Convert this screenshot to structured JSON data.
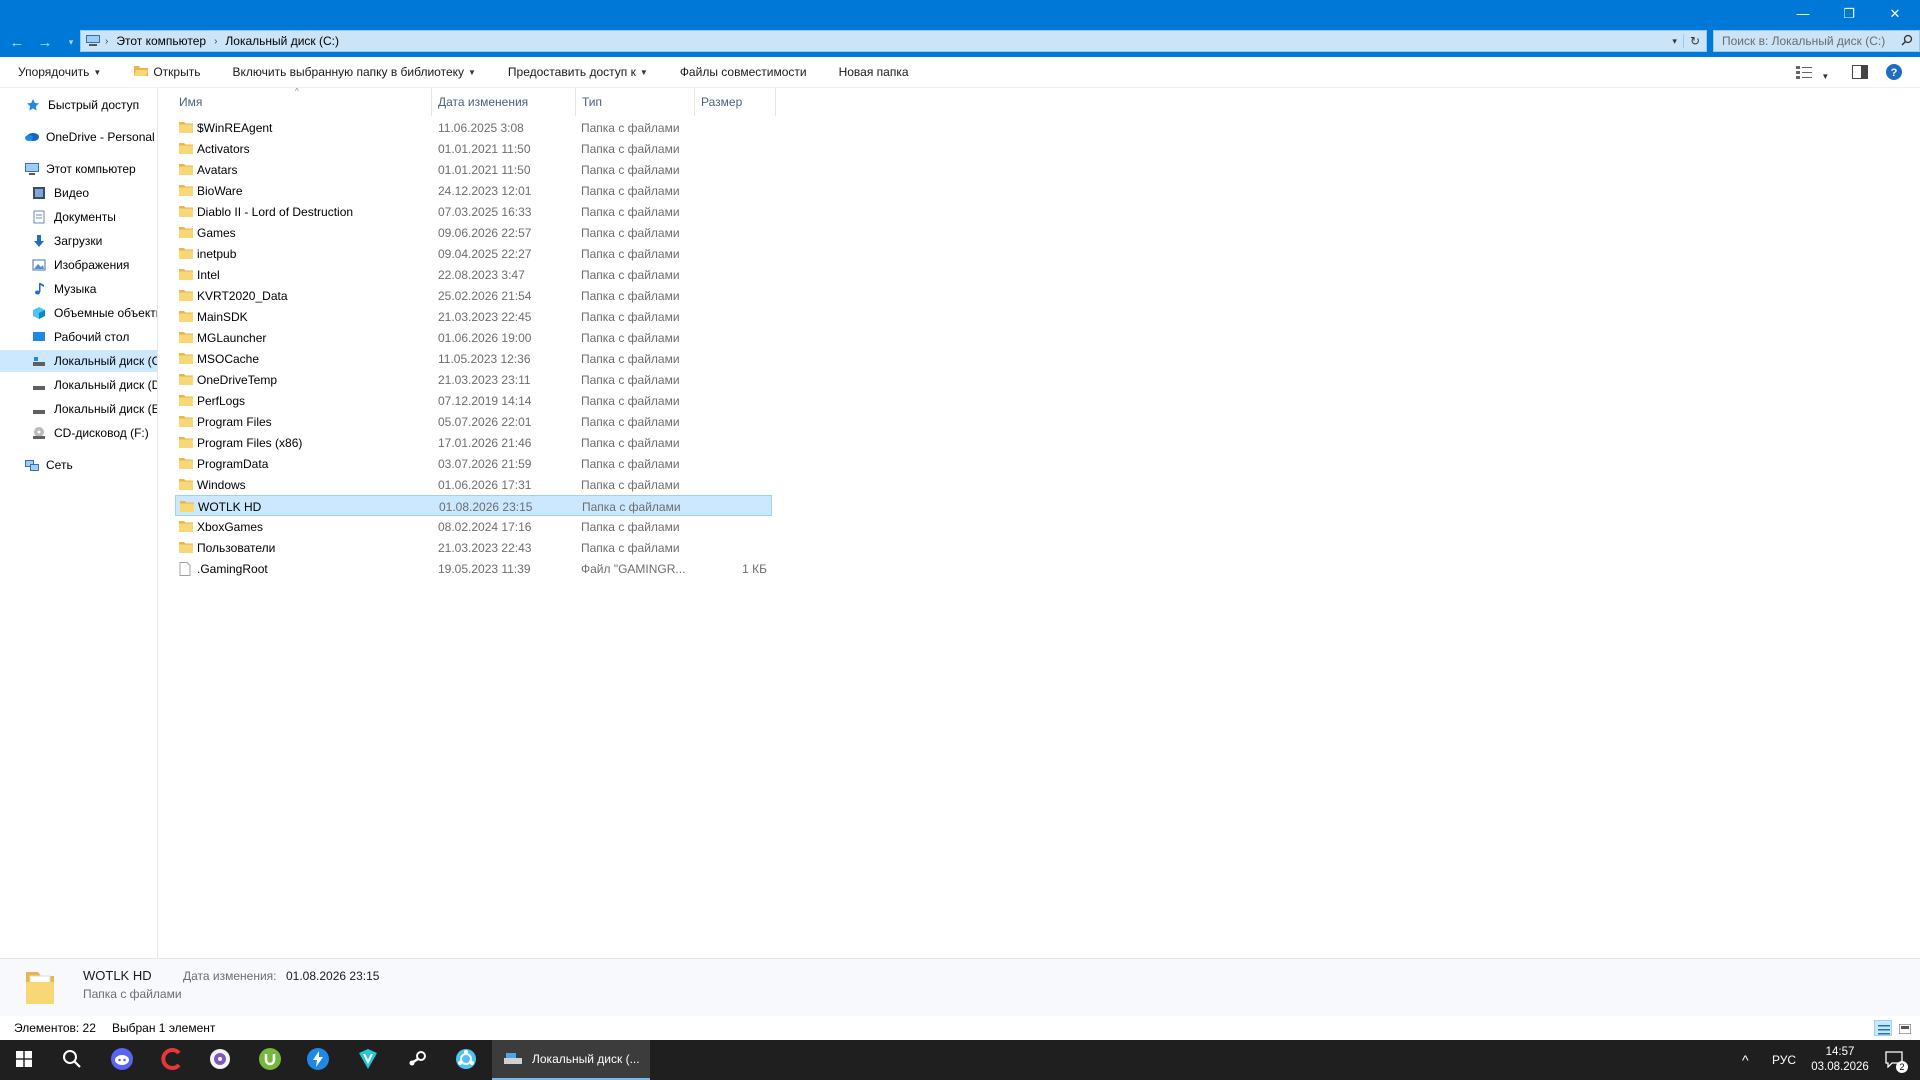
{
  "window": {
    "minimize": "—",
    "restore": "❐",
    "close": "✕"
  },
  "address": {
    "segments": [
      "Этот компьютер",
      "Локальный диск (C:)"
    ],
    "search_placeholder": "Поиск в: Локальный диск (C:)"
  },
  "toolbar": {
    "organize": "Упорядочить",
    "open": "Открыть",
    "include_library": "Включить выбранную папку в библиотеку",
    "share": "Предоставить доступ к",
    "compat": "Файлы совместимости",
    "new_folder": "Новая папка"
  },
  "nav": {
    "items": [
      {
        "label": "Быстрый доступ",
        "icon": "star-icon"
      },
      {
        "label": "OneDrive - Personal",
        "icon": "cloud-icon"
      },
      {
        "label": "Этот компьютер",
        "icon": "computer-icon"
      },
      {
        "label": "Видео",
        "icon": "video-icon"
      },
      {
        "label": "Документы",
        "icon": "documents-icon"
      },
      {
        "label": "Загрузки",
        "icon": "download-icon"
      },
      {
        "label": "Изображения",
        "icon": "pictures-icon"
      },
      {
        "label": "Музыка",
        "icon": "music-icon"
      },
      {
        "label": "Объемные объекты",
        "icon": "3d-objects-icon"
      },
      {
        "label": "Рабочий стол",
        "icon": "desktop-icon"
      },
      {
        "label": "Локальный диск (C:)",
        "icon": "drive-icon"
      },
      {
        "label": "Локальный диск (D:)",
        "icon": "drive-icon"
      },
      {
        "label": "Локальный диск (E:)",
        "icon": "drive-icon"
      },
      {
        "label": "CD-дисковод (F:)",
        "icon": "cd-drive-icon"
      },
      {
        "label": "Сеть",
        "icon": "network-icon"
      }
    ]
  },
  "columns": {
    "name": "Имя",
    "date": "Дата изменения",
    "type": "Тип",
    "size": "Размер"
  },
  "files": [
    {
      "name": "$WinREAgent",
      "date": "11.06.2025 3:08",
      "type": "Папка с файлами",
      "size": ""
    },
    {
      "name": "Activators",
      "date": "01.01.2021 11:50",
      "type": "Папка с файлами",
      "size": ""
    },
    {
      "name": "Avatars",
      "date": "01.01.2021 11:50",
      "type": "Папка с файлами",
      "size": ""
    },
    {
      "name": "BioWare",
      "date": "24.12.2023 12:01",
      "type": "Папка с файлами",
      "size": ""
    },
    {
      "name": "Diablo II - Lord of Destruction",
      "date": "07.03.2025 16:33",
      "type": "Папка с файлами",
      "size": ""
    },
    {
      "name": "Games",
      "date": "09.06.2026 22:57",
      "type": "Папка с файлами",
      "size": ""
    },
    {
      "name": "inetpub",
      "date": "09.04.2025 22:27",
      "type": "Папка с файлами",
      "size": ""
    },
    {
      "name": "Intel",
      "date": "22.08.2023 3:47",
      "type": "Папка с файлами",
      "size": ""
    },
    {
      "name": "KVRT2020_Data",
      "date": "25.02.2026 21:54",
      "type": "Папка с файлами",
      "size": ""
    },
    {
      "name": "MainSDK",
      "date": "21.03.2023 22:45",
      "type": "Папка с файлами",
      "size": ""
    },
    {
      "name": "MGLauncher",
      "date": "01.06.2026 19:00",
      "type": "Папка с файлами",
      "size": ""
    },
    {
      "name": "MSOCache",
      "date": "11.05.2023 12:36",
      "type": "Папка с файлами",
      "size": ""
    },
    {
      "name": "OneDriveTemp",
      "date": "21.03.2023 23:11",
      "type": "Папка с файлами",
      "size": ""
    },
    {
      "name": "PerfLogs",
      "date": "07.12.2019 14:14",
      "type": "Папка с файлами",
      "size": ""
    },
    {
      "name": "Program Files",
      "date": "05.07.2026 22:01",
      "type": "Папка с файлами",
      "size": ""
    },
    {
      "name": "Program Files (x86)",
      "date": "17.01.2026 21:46",
      "type": "Папка с файлами",
      "size": ""
    },
    {
      "name": "ProgramData",
      "date": "03.07.2026 21:59",
      "type": "Папка с файлами",
      "size": ""
    },
    {
      "name": "Windows",
      "date": "01.06.2026 17:31",
      "type": "Папка с файлами",
      "size": ""
    },
    {
      "name": "WOTLK HD",
      "date": "01.08.2026 23:15",
      "type": "Папка с файлами",
      "size": "",
      "selected": true
    },
    {
      "name": "XboxGames",
      "date": "08.02.2024 17:16",
      "type": "Папка с файлами",
      "size": ""
    },
    {
      "name": "Пользователи",
      "date": "21.03.2023 22:43",
      "type": "Папка с файлами",
      "size": ""
    },
    {
      "name": ".GamingRoot",
      "date": "19.05.2023 11:39",
      "type": "Файл \"GAMINGR...",
      "size": "1 КБ",
      "is_file": true
    }
  ],
  "details": {
    "name": "WOTLK HD",
    "type": "Папка с файлами",
    "date_label": "Дата изменения:",
    "date_value": "01.08.2026 23:15"
  },
  "status": {
    "count": "Элементов: 22",
    "selected": "Выбран 1 элемент"
  },
  "taskbar": {
    "active_window": "Локальный диск (...",
    "language": "РУС",
    "time": "14:57",
    "date": "03.08.2026",
    "notifications": "2"
  },
  "colors": {
    "accent": "#0078d7",
    "selection": "#cce8ff",
    "folder": "#f8d775"
  }
}
